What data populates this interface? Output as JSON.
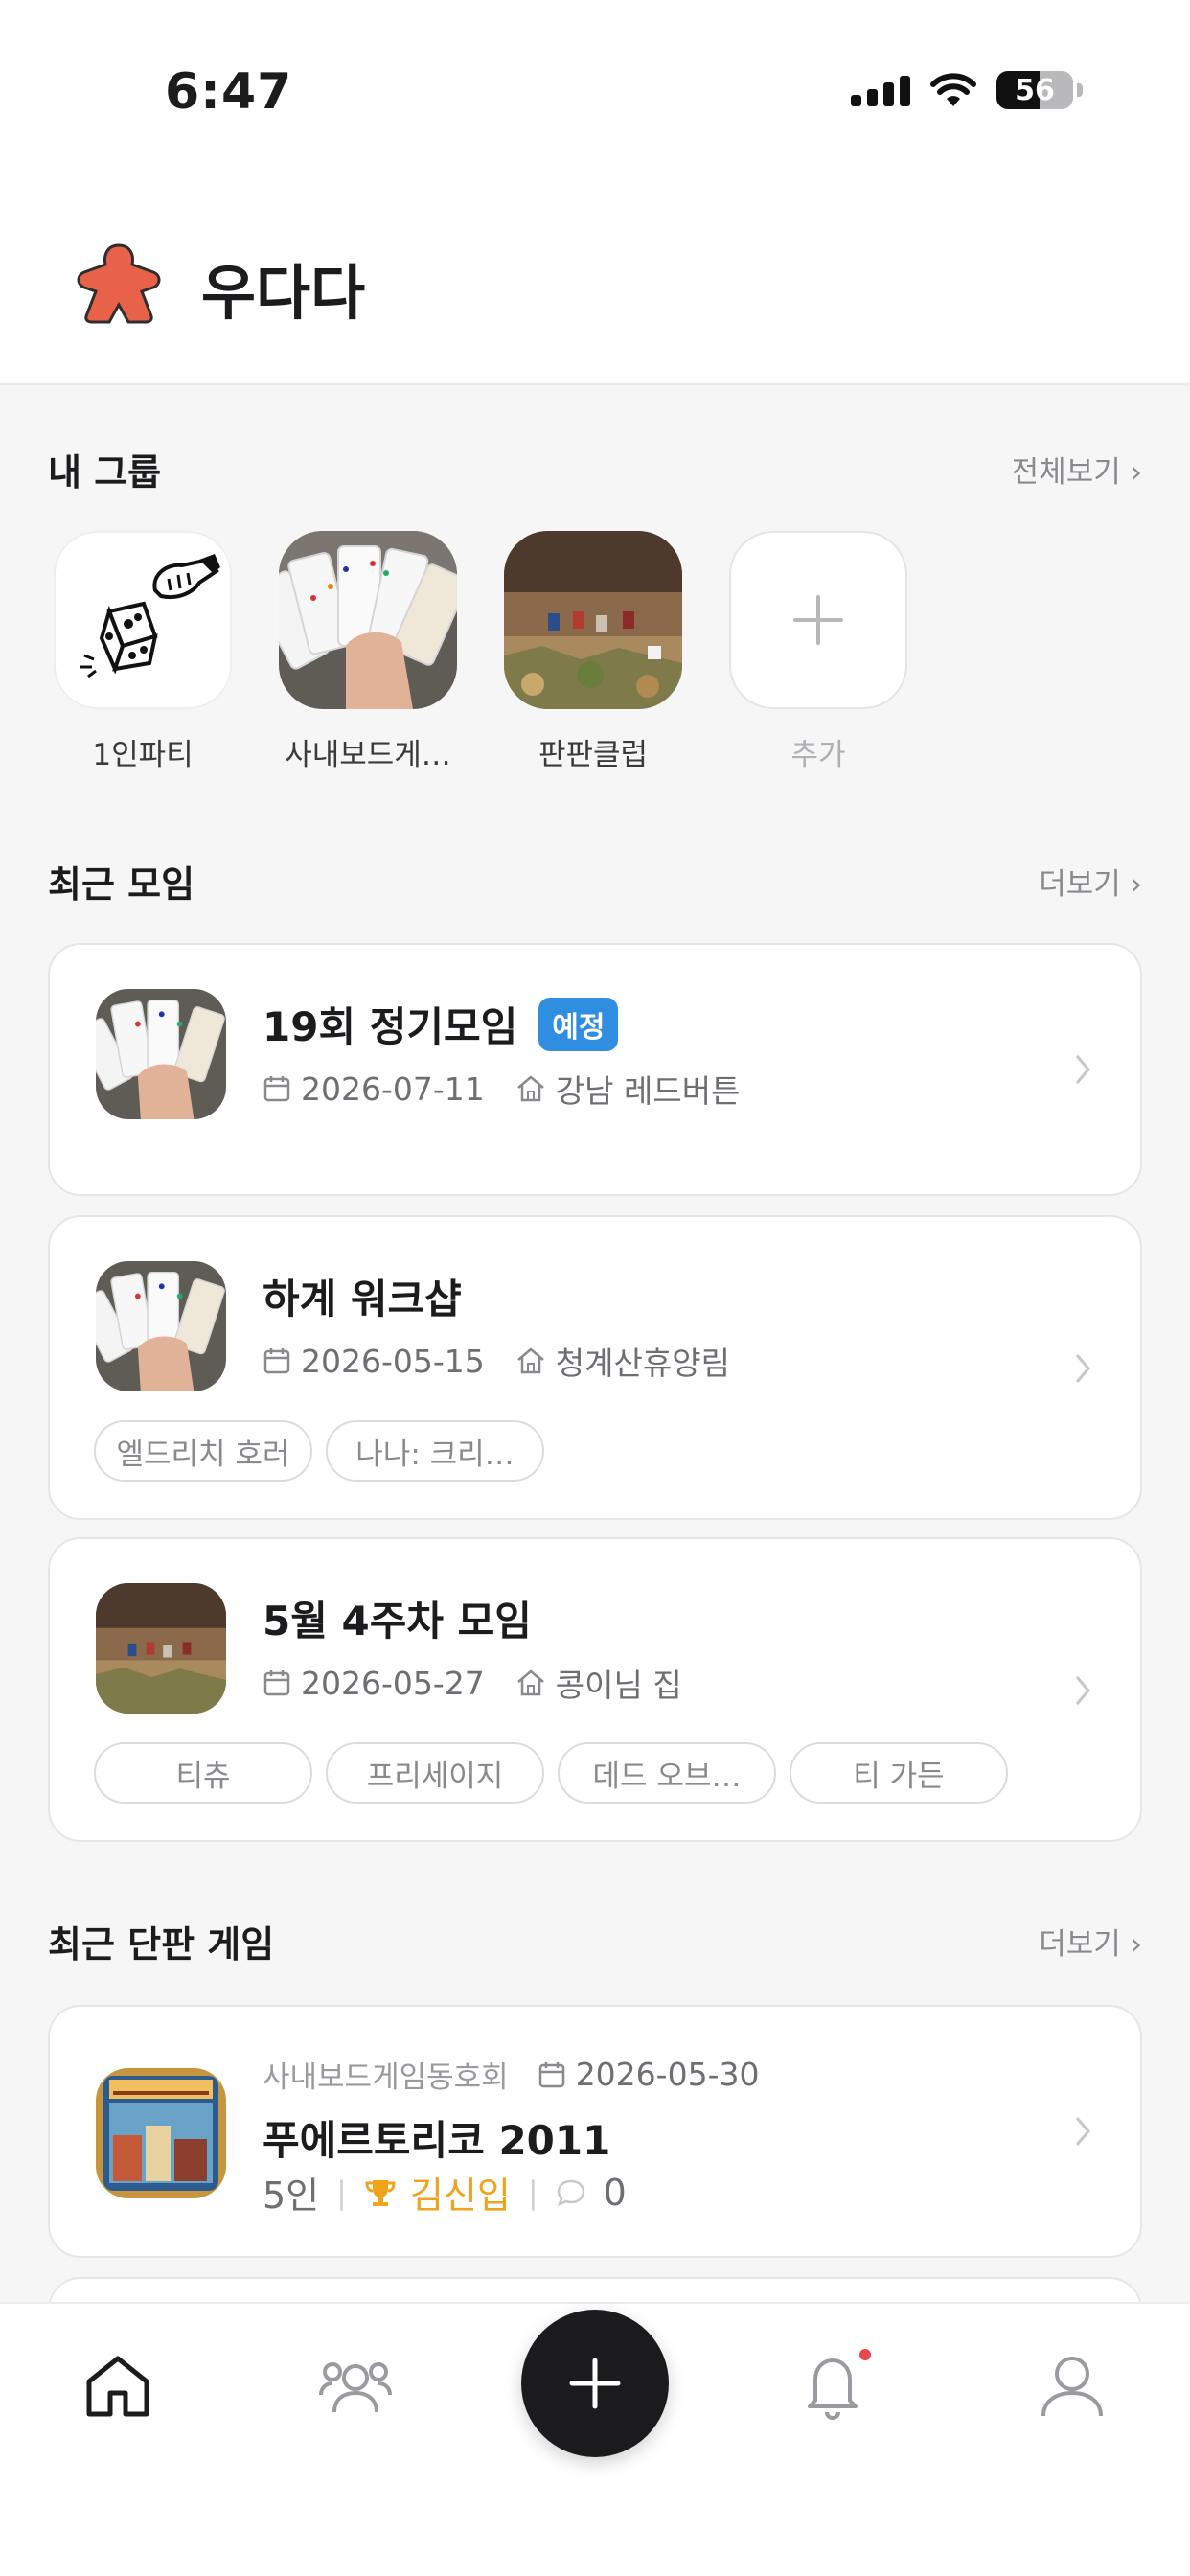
{
  "status_bar": {
    "time": "6:47",
    "battery": "56"
  },
  "header": {
    "app_title": "우다다"
  },
  "groups_section": {
    "title": "내 그룹",
    "view_all": "전체보기 ›",
    "items": [
      {
        "name": "1인파티"
      },
      {
        "name": "사내보드게…"
      },
      {
        "name": "판판클럽"
      }
    ],
    "add_label": "추가"
  },
  "meetings_section": {
    "title": "최근 모임",
    "more": "더보기 ›",
    "items": [
      {
        "title": "19회 정기모임",
        "badge": "예정",
        "date": "2026-07-11",
        "place": "강남 레드버튼",
        "tags": []
      },
      {
        "title": "하계 워크샵",
        "badge": "",
        "date": "2026-05-15",
        "place": "청계산휴양림",
        "tags": [
          "엘드리치 호러",
          "나나: 크리…"
        ]
      },
      {
        "title": "5월 4주차 모임",
        "badge": "",
        "date": "2026-05-27",
        "place": "콩이님 집",
        "tags": [
          "티츄",
          "프리세이지",
          "데드 오브…",
          "티 가든"
        ]
      }
    ]
  },
  "games_section": {
    "title": "최근 단판 게임",
    "more": "더보기 ›",
    "items": [
      {
        "group": "사내보드게임동호회",
        "date": "2026-05-30",
        "title": "푸에르토리코 2011",
        "players": "5인",
        "winner": "김신입",
        "comments": "0"
      }
    ]
  },
  "tabbar": {
    "icons": [
      "home-icon",
      "groups-icon",
      "plus-icon",
      "bell-icon",
      "profile-icon"
    ],
    "notification_color": "#e5484d"
  },
  "colors": {
    "accent": "#2f8ee0",
    "brand": "#e8624a",
    "winner": "#f0a31c"
  }
}
